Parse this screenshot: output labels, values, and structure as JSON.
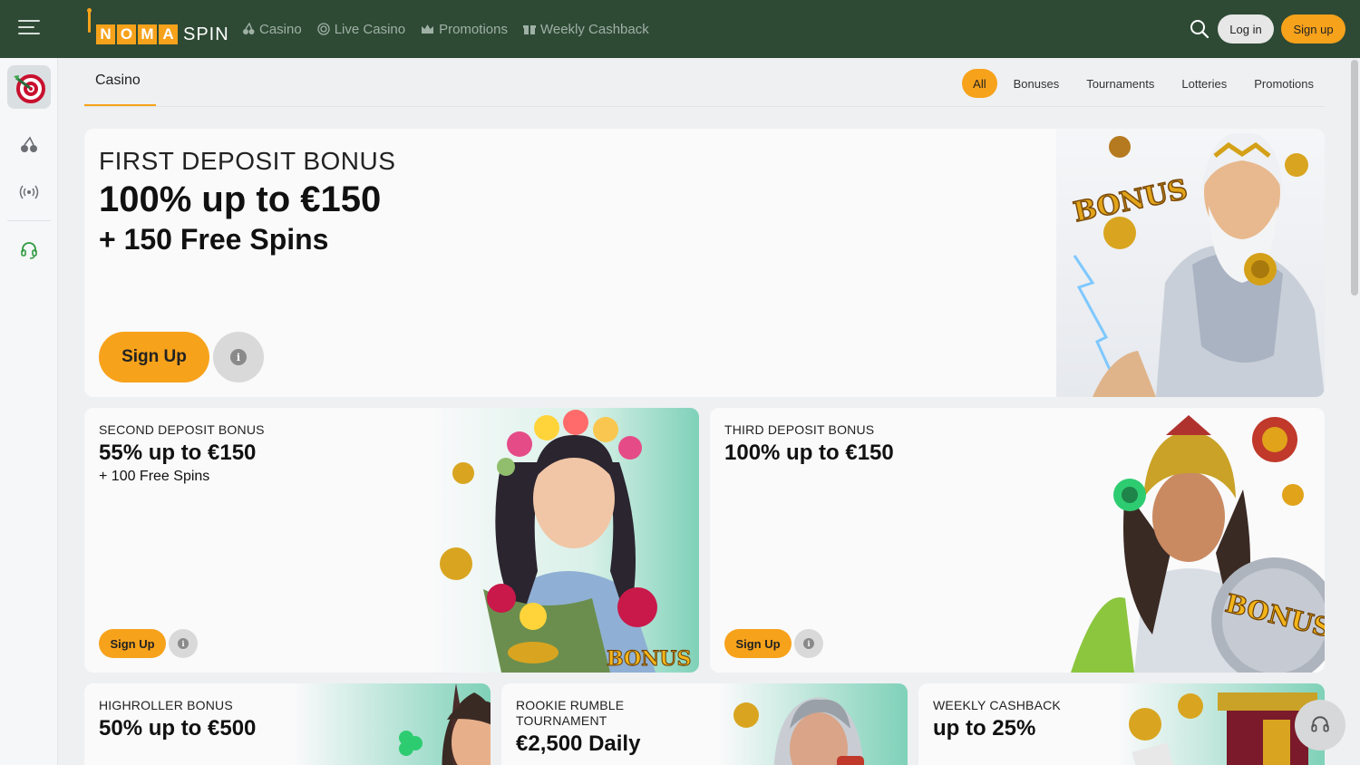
{
  "header": {
    "logo_letters": [
      "N",
      "O",
      "M",
      "A"
    ],
    "logo_suffix": "SPIN",
    "nav": [
      {
        "label": "Casino",
        "icon": "cherries-icon"
      },
      {
        "label": "Live Casino",
        "icon": "live-icon"
      },
      {
        "label": "Promotions",
        "icon": "crown-icon"
      },
      {
        "label": "Weekly Cashback",
        "icon": "gift-icon"
      }
    ],
    "login_label": "Log in",
    "signup_label": "Sign up"
  },
  "sidebar": {
    "items": [
      "darts-icon",
      "cherries-icon",
      "live-signal-icon",
      "support-headset-icon"
    ]
  },
  "subnav": {
    "title": "Casino",
    "filters": [
      "All",
      "Bonuses",
      "Tournaments",
      "Lotteries",
      "Promotions"
    ],
    "active_filter": "All"
  },
  "promos": {
    "first": {
      "subtitle": "FIRST DEPOSIT BONUS",
      "headline": "100% up to €150",
      "extra": "+ 150 Free Spins",
      "cta": "Sign Up",
      "art_text": "BONUS"
    },
    "second": {
      "subtitle": "SECOND DEPOSIT BONUS",
      "headline": "55% up to €150",
      "extra": "+ 100 Free Spins",
      "cta": "Sign Up",
      "art_text": "BONUS"
    },
    "third": {
      "subtitle": "THIRD DEPOSIT BONUS",
      "headline": "100% up to €150",
      "cta": "Sign Up",
      "art_text": "BONUS"
    },
    "highroller": {
      "subtitle": "HIGHROLLER BONUS",
      "headline": "50% up to €500"
    },
    "rookie": {
      "subtitle_line1": "ROOKIE RUMBLE",
      "subtitle_line2": "TOURNAMENT",
      "headline": "€2,500 Daily"
    },
    "cashback": {
      "subtitle": "WEEKLY CASHBACK",
      "headline": "up to 25%"
    }
  },
  "info_glyph": "i",
  "colors": {
    "header_bg": "#2e4a35",
    "accent": "#f7a21b",
    "page_bg": "#eef0f2"
  }
}
